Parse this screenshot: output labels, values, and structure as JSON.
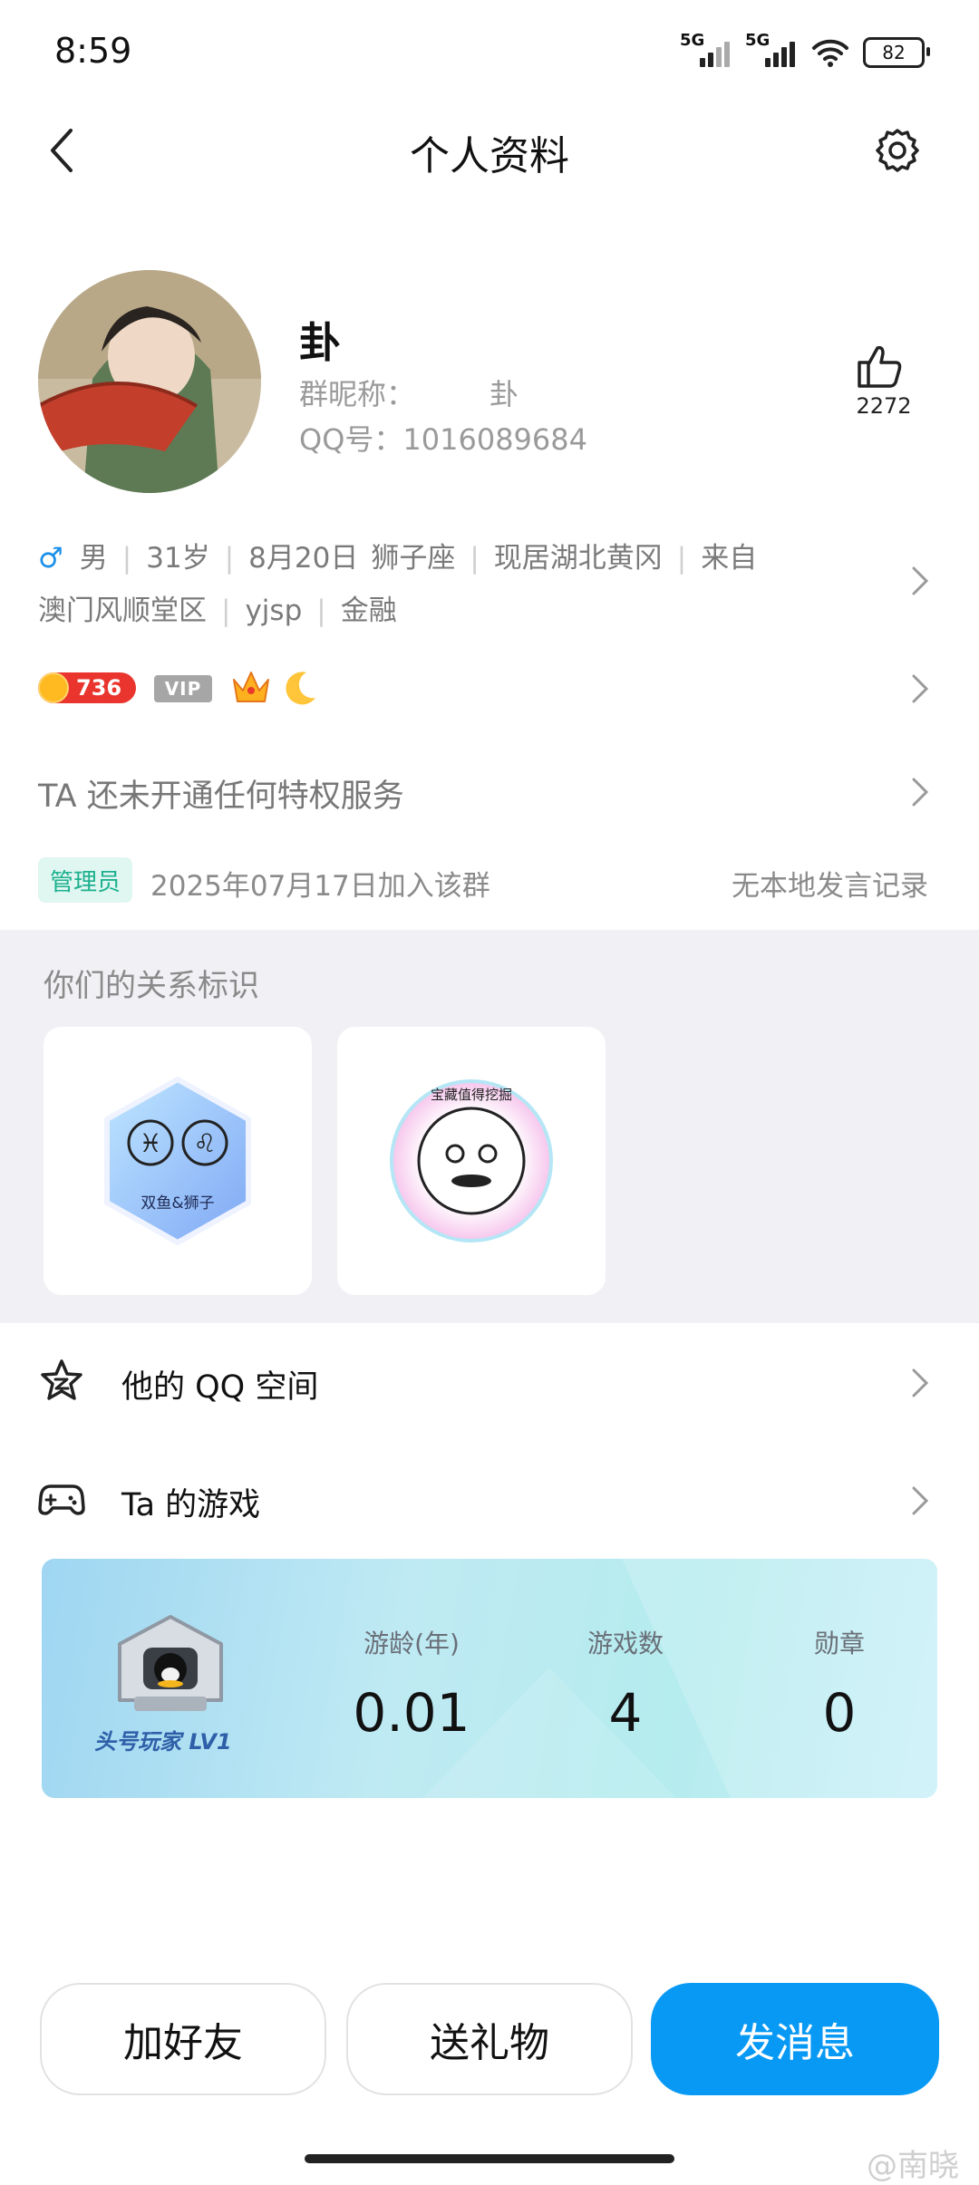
{
  "status_bar": {
    "time": "8:59",
    "signal1": "5G",
    "signal2": "5G",
    "battery": "82"
  },
  "header": {
    "title": "个人资料"
  },
  "profile": {
    "name": "卦",
    "nick_label": "群昵称：",
    "nick_value": "卦",
    "qq_label": "QQ号：",
    "qq_value": "1016089684",
    "like_count": "2272"
  },
  "info": {
    "gender_symbol": "♂",
    "gender": "男",
    "age": "31岁",
    "birthday": "8月20日",
    "zodiac": "狮子座",
    "location": "现居湖北黄冈",
    "from_label": "来自",
    "hometown": "澳门风顺堂区",
    "school": "yjsp",
    "industry": "金融"
  },
  "badges": {
    "coin_level": "736",
    "vip": "VIP"
  },
  "privilege": "TA 还未开通任何特权服务",
  "group": {
    "role": "管理员",
    "join_text": "2025年07月17日加入该群",
    "speech_record": "无本地发言记录"
  },
  "relation": {
    "title": "你们的关系标识",
    "cards": [
      {
        "label": "双鱼&狮子",
        "icon": "zodiac-badge-icon"
      },
      {
        "label": "宝藏值得挖掘",
        "icon": "treasure-badge-icon"
      }
    ]
  },
  "rows": {
    "qzone": {
      "label": "他的 QQ 空间",
      "icon": "star-icon"
    },
    "games": {
      "label": "Ta 的游戏",
      "icon": "gamepad-icon"
    }
  },
  "game_card": {
    "level_text": "头号玩家 LV1",
    "stats": [
      {
        "label": "游龄(年)",
        "value": "0.01"
      },
      {
        "label": "游戏数",
        "value": "4"
      },
      {
        "label": "勋章",
        "value": "0"
      }
    ]
  },
  "buttons": {
    "add_friend": "加好友",
    "send_gift": "送礼物",
    "send_message": "发消息"
  },
  "watermark": "@南晓",
  "colors": {
    "accent": "#0899f5",
    "admin": "#1db08e",
    "coin": "#e9352d"
  }
}
